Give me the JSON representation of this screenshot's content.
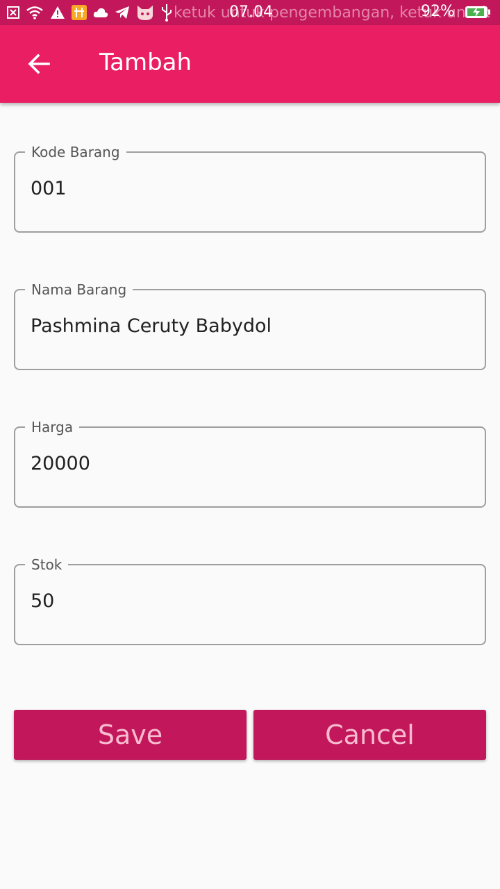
{
  "status_bar": {
    "notification_text": "ketuk untuk pengembangan, ketuk untuk",
    "time": "07.04",
    "battery_percent_text": "92%",
    "battery_level": 0.92,
    "charging": true,
    "icons": [
      "close-box-icon",
      "wifi-icon",
      "warning-icon",
      "usb-debug-icon",
      "cloud-icon",
      "telegram-icon",
      "cat-face-icon",
      "usb-icon"
    ]
  },
  "app_bar": {
    "title": "Tambah",
    "background": "#e91e63"
  },
  "form": {
    "fields": [
      {
        "label": "Kode Barang",
        "value": "001"
      },
      {
        "label": "Nama Barang",
        "value": "Pashmina Ceruty Babydol"
      },
      {
        "label": "Harga",
        "value": "20000"
      },
      {
        "label": "Stok",
        "value": "50"
      }
    ]
  },
  "actions": {
    "save_label": "Save",
    "cancel_label": "Cancel",
    "button_color": "#c2185b",
    "button_text_color": "#f8bbd0"
  }
}
